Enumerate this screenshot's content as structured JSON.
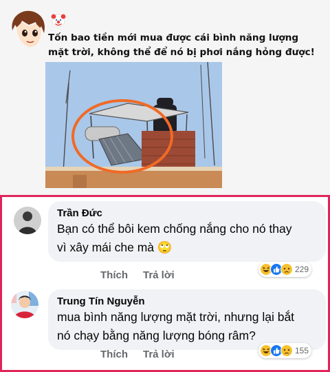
{
  "post": {
    "caption": "Tốn bao tiền mới mua được cái bình năng lượng\nmặt trời, không thể để nó bị phơi nắng hỏng được!",
    "icons": {
      "avatar": "anime-boy-avatar",
      "badge": "clown-face-icon",
      "photo": "solar-water-heater-under-shade-roof"
    },
    "highlight_color": "#f06a26"
  },
  "comments": [
    {
      "author": "Trần Đức",
      "text": "Bạn có thể bôi kem chống nắng cho nó thay\nvì xây mái che mà 🙄",
      "like_label": "Thích",
      "reply_label": "Trả lời",
      "reactions": [
        "haha",
        "like",
        "sad"
      ],
      "reaction_count": "229"
    },
    {
      "author": "Trung Tín Nguyễn",
      "text": "mua bình năng lượng mặt trời, nhưng lại bắt\nnó chạy bằng năng lượng bóng râm?",
      "like_label": "Thích",
      "reply_label": "Trả lời",
      "reactions": [
        "haha",
        "like",
        "sad"
      ],
      "reaction_count": "155"
    }
  ],
  "colors": {
    "frame": "#e0255a",
    "bubble": "#f0f2f5",
    "meta": "#65676b",
    "like": "#1877f2"
  }
}
